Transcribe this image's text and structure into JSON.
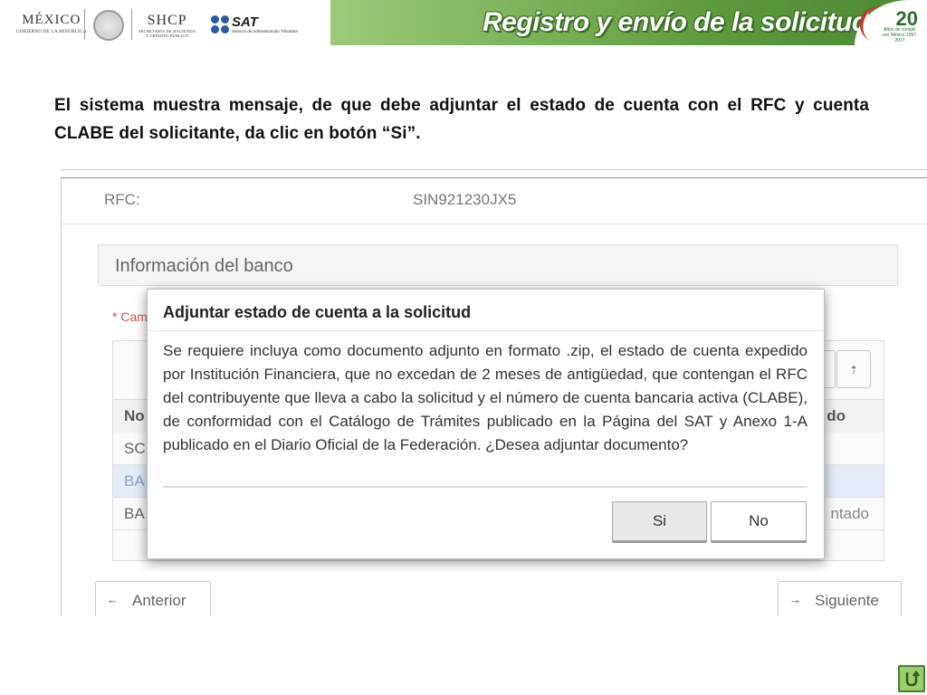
{
  "header": {
    "logo_mexico": {
      "name": "MÉXICO",
      "subtitle": "GOBIERNO DE LA REPÚBLICA"
    },
    "logo_shcp": {
      "name": "SHCP",
      "subtitle_line1": "SECRETARÍA DE HACIENDA",
      "subtitle_line2": "Y CRÉDITO PÚBLICO"
    },
    "logo_sat": {
      "name": "SAT",
      "subtitle": "Servicio de Administración Tributaria"
    },
    "title": "Registro y envío de la solicitud",
    "anniversary": {
      "number": "20",
      "text": "Años de cumplir con México 1997-2017"
    }
  },
  "instruction": "El sistema muestra mensaje, de que debe adjuntar el estado de cuenta con el RFC y cuenta CLABE del solicitante, da clic en botón “Si”.",
  "screenshot": {
    "rfc_label": "RFC:",
    "rfc_value": "SIN921230JX5",
    "bank_section_title": "Información del banco",
    "required_note": "* Cam",
    "table": {
      "header_col1": "No",
      "header_col2": "do",
      "rows": [
        {
          "col1": "SC",
          "col2": ""
        },
        {
          "col1": "BA",
          "col2": ""
        },
        {
          "col1": "BA",
          "col2": "ntado"
        }
      ],
      "button_icon": "⇡"
    },
    "prev_button": {
      "arrow": "←",
      "label": "Anterior"
    },
    "next_button": {
      "arrow": "→",
      "label": "Siguiente"
    }
  },
  "modal": {
    "title": "Adjuntar estado de cuenta a la solicitud",
    "body": "Se requiere incluya como documento adjunto en formato .zip, el estado de cuenta expedido por Institución Financiera, que no excedan de 2 meses de antigüedad, que contengan el RFC del contribuyente que lleva a cabo la solicitud y el número de cuenta bancaria activa (CLABE), de conformidad con el Catálogo de Trámites publicado en la Página del SAT y Anexo 1-A publicado en el Diario Oficial de la Federación. ¿Desea adjuntar documento?",
    "yes_label": "Si",
    "no_label": "No"
  },
  "icons": {
    "return": "return-arrow-icon"
  },
  "colors": {
    "header_green": "#5b9a3c",
    "return_green": "#9bcf6a",
    "required_red": "#d9534f"
  }
}
